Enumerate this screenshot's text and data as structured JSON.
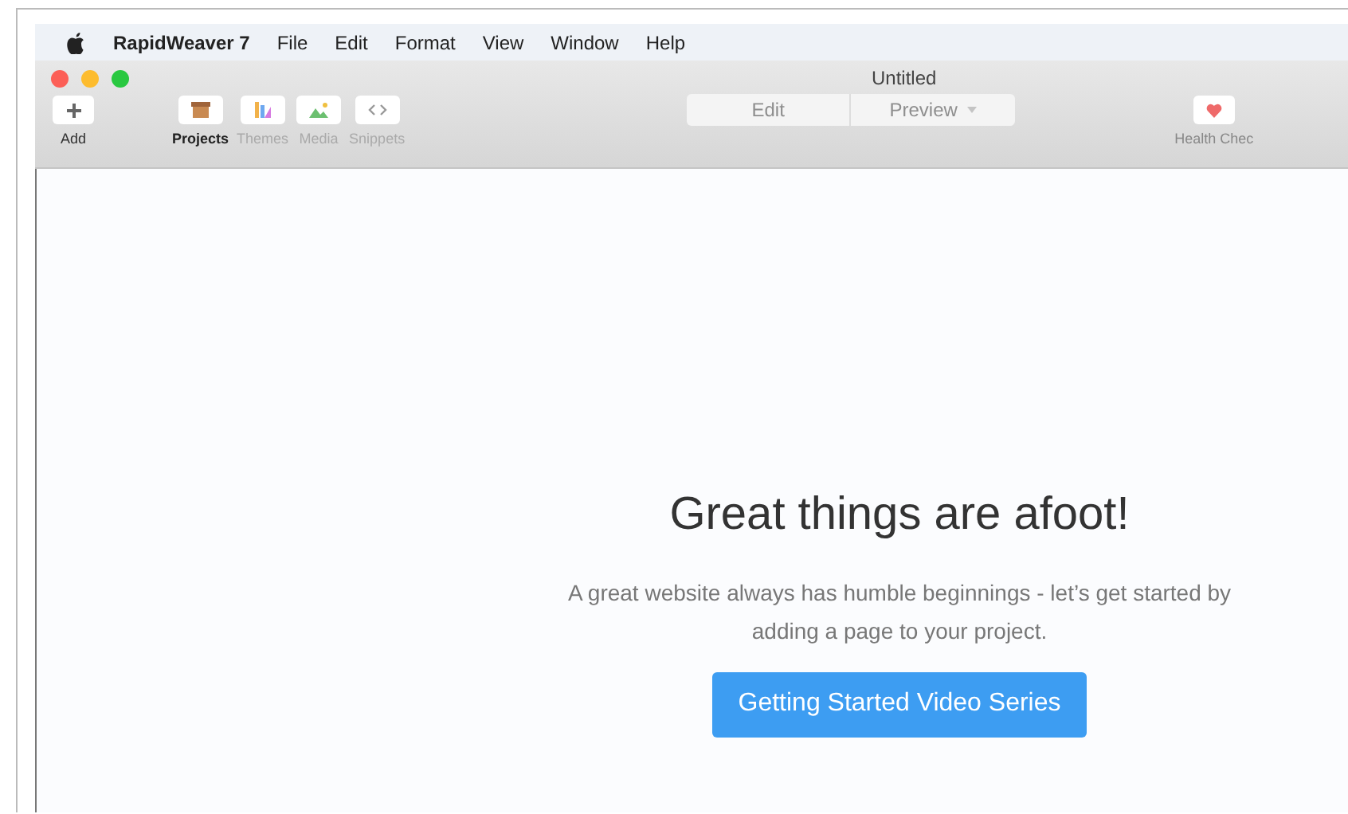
{
  "menu_bar": {
    "app": "RapidWeaver 7",
    "items": [
      "File",
      "Edit",
      "Format",
      "View",
      "Window",
      "Help"
    ]
  },
  "window": {
    "title": "Untitled"
  },
  "toolbar": {
    "add": {
      "label": "Add"
    },
    "views": [
      {
        "label": "Projects",
        "kind": "projects",
        "selected": true
      },
      {
        "label": "Themes",
        "kind": "themes",
        "selected": false
      },
      {
        "label": "Media",
        "kind": "media",
        "selected": false
      },
      {
        "label": "Snippets",
        "kind": "snippets",
        "selected": false
      }
    ],
    "mode": [
      {
        "label": "Edit",
        "disabled": true
      },
      {
        "label": "Preview",
        "disabled": true
      }
    ],
    "health": {
      "label": "Health Chec"
    }
  },
  "content": {
    "heading": "Great things are afoot!",
    "message": "A great website always has humble beginnings - let’s get started by adding a page to your project.",
    "button": "Getting Started Video Series"
  }
}
